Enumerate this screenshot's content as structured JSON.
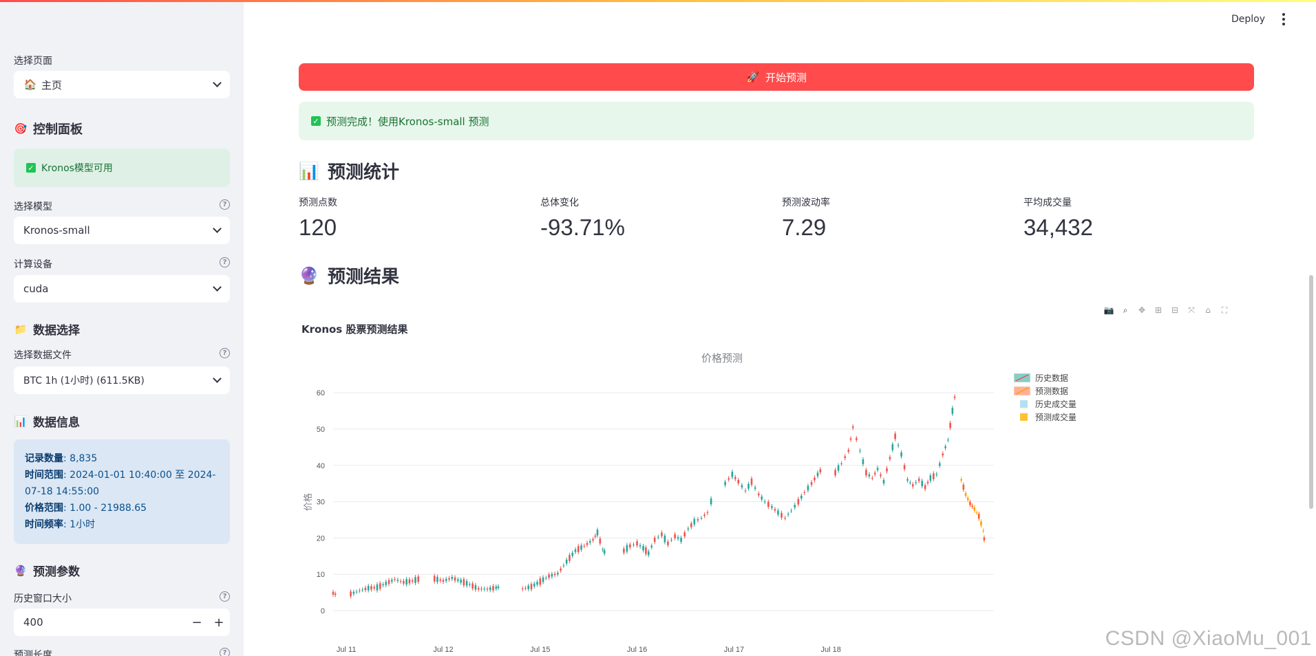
{
  "app": {
    "deploy_label": "Deploy"
  },
  "sidebar": {
    "page_select": {
      "label": "选择页面",
      "value": "主页",
      "icon": "house-icon"
    },
    "control_panel": {
      "title": "控制面板",
      "icon": "target-icon"
    },
    "model_status": {
      "text": "Kronos模型可用"
    },
    "model_select": {
      "label": "选择模型",
      "value": "Kronos-small"
    },
    "device_select": {
      "label": "计算设备",
      "value": "cuda"
    },
    "data_select_section": {
      "title": "数据选择",
      "icon": "folder-icon"
    },
    "data_file_select": {
      "label": "选择数据文件",
      "value": "BTC 1h (1小时) (611.5KB)"
    },
    "data_info_section": {
      "title": "数据信息",
      "icon": "bar-chart-icon"
    },
    "data_info": {
      "records_label": "记录数量",
      "records_value": ": 8,835",
      "range_label": "时间范围",
      "range_value": ": 2024-01-01 10:40:00 至 2024-07-18 14:55:00",
      "price_label": "价格范围",
      "price_value": ": 1.00 - 21988.65",
      "freq_label": "时间频率",
      "freq_value": ": 1小时"
    },
    "params_section": {
      "title": "预测参数",
      "icon": "crystal-ball-icon"
    },
    "history_window": {
      "label": "历史窗口大小",
      "value": "400"
    },
    "pred_length": {
      "label": "预测长度"
    }
  },
  "main": {
    "run_button": {
      "label": "开始预测",
      "icon": "rocket-icon"
    },
    "success": {
      "text": "预测完成！使用Kronos-small 预测"
    },
    "stats_section": {
      "title": "预测统计",
      "icon": "bar-chart-icon"
    },
    "metrics": [
      {
        "label": "预测点数",
        "value": "120"
      },
      {
        "label": "总体变化",
        "value": "-93.71%"
      },
      {
        "label": "预测波动率",
        "value": "7.29"
      },
      {
        "label": "平均成交量",
        "value": "34,432"
      }
    ],
    "results_section": {
      "title": "预测结果",
      "icon": "crystal-ball-icon"
    },
    "chart_title": "Kronos 股票预测结果",
    "watermark": "CSDN @XiaoMu_001"
  },
  "chart_data": {
    "type": "candlestick",
    "title": "价格预测",
    "ylabel": "价格",
    "ylim": [
      0,
      64
    ],
    "yticks": [
      0,
      10,
      20,
      30,
      40,
      50,
      60
    ],
    "xticks": [
      "Jul 11",
      "Jul 12",
      "Jul 15",
      "Jul 16",
      "Jul 17",
      "Jul 18"
    ],
    "legend": [
      {
        "name": "历史数据",
        "color": "#26a69a"
      },
      {
        "name": "预测数据",
        "color": "#ff7043"
      },
      {
        "name": "历史成交量",
        "color": "#b3e0f2"
      },
      {
        "name": "预测成交量",
        "color": "#ffc233"
      }
    ],
    "series": [
      {
        "name": "历史数据",
        "segments": [
          [
            [
              0.0,
              4.8
            ],
            [
              0.5,
              4.2
            ]
          ],
          [
            [
              2.0,
              4.6
            ],
            [
              3.0,
              5.5
            ],
            [
              4.0,
              6.2
            ],
            [
              5.0,
              6.4
            ],
            [
              6.0,
              7.5
            ],
            [
              7.0,
              8.6
            ],
            [
              8.0,
              7.8
            ],
            [
              9.0,
              8.2
            ],
            [
              10.0,
              8.9
            ]
          ],
          [
            [
              11.5,
              8.8
            ],
            [
              12.5,
              8.2
            ],
            [
              13.5,
              9.0
            ],
            [
              14.5,
              8.1
            ],
            [
              15.5,
              7.2
            ],
            [
              16.5,
              6.0
            ],
            [
              17.5,
              5.9
            ],
            [
              18.5,
              6.3
            ],
            [
              19.0,
              6.6
            ]
          ],
          [
            [
              21.5,
              6.0
            ],
            [
              22.5,
              6.6
            ],
            [
              23.5,
              8.0
            ],
            [
              24.5,
              9.5
            ],
            [
              25.5,
              10.2
            ],
            [
              26.5,
              13.5
            ],
            [
              27.5,
              16.5
            ],
            [
              28.5,
              17.8
            ],
            [
              29.5,
              19.5
            ],
            [
              30.0,
              21.5
            ],
            [
              30.6,
              16.8
            ],
            [
              31.0,
              15.5
            ]
          ],
          [
            [
              33.0,
              16.5
            ],
            [
              33.7,
              17.8
            ],
            [
              34.5,
              18.5
            ],
            [
              35.2,
              17.2
            ],
            [
              35.8,
              15.8
            ],
            [
              36.5,
              19.5
            ],
            [
              37.3,
              21.0
            ],
            [
              38.0,
              18.5
            ],
            [
              38.8,
              20.5
            ],
            [
              39.5,
              19.5
            ],
            [
              40.3,
              22.5
            ],
            [
              41.0,
              24.5
            ],
            [
              41.8,
              25.5
            ],
            [
              42.5,
              27.0
            ],
            [
              43.3,
              33.2
            ]
          ],
          [
            [
              44.5,
              35.0
            ],
            [
              45.3,
              37.5
            ],
            [
              46.0,
              35.5
            ],
            [
              46.8,
              33.0
            ],
            [
              47.5,
              35.5
            ],
            [
              48.3,
              32.0
            ],
            [
              49.0,
              30.0
            ],
            [
              49.8,
              28.5
            ],
            [
              50.5,
              27.0
            ],
            [
              51.3,
              25.5
            ],
            [
              52.0,
              27.5
            ],
            [
              52.8,
              30.0
            ],
            [
              53.5,
              32.5
            ],
            [
              54.3,
              35.0
            ],
            [
              55.0,
              37.5
            ],
            [
              55.6,
              39.5
            ]
          ],
          [
            [
              57.0,
              38.0
            ],
            [
              57.7,
              40.5
            ],
            [
              58.5,
              44.0
            ],
            [
              59.0,
              50.5
            ],
            [
              59.8,
              44.0
            ],
            [
              60.5,
              38.0
            ],
            [
              61.2,
              36.5
            ],
            [
              61.8,
              39.0
            ],
            [
              62.5,
              35.5
            ],
            [
              63.2,
              42.0
            ],
            [
              63.8,
              48.0
            ],
            [
              64.5,
              43.0
            ],
            [
              65.2,
              36.0
            ],
            [
              65.8,
              34.5
            ],
            [
              66.5,
              36.0
            ],
            [
              67.2,
              34.0
            ],
            [
              67.8,
              36.5
            ],
            [
              68.5,
              37.5
            ],
            [
              69.2,
              43.0
            ],
            [
              69.8,
              47.0
            ],
            [
              70.3,
              55.0
            ],
            [
              70.8,
              62.5
            ]
          ]
        ]
      },
      {
        "name": "预测数据",
        "segments": [
          [
            [
              71.3,
              36.0
            ],
            [
              71.8,
              32.0
            ],
            [
              72.3,
              29.5
            ],
            [
              72.8,
              28.0
            ],
            [
              73.3,
              26.0
            ],
            [
              73.8,
              22.0
            ],
            [
              74.0,
              17.5
            ]
          ]
        ]
      }
    ]
  }
}
